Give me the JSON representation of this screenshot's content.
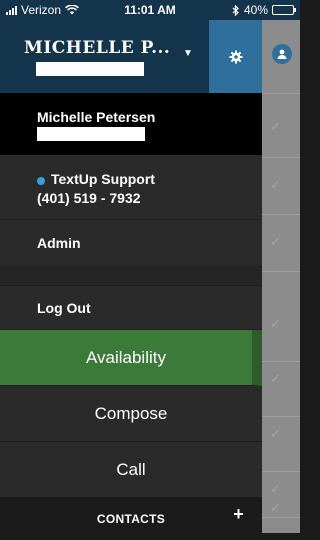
{
  "status_bar": {
    "carrier": "Verizon",
    "time": "11:01 AM",
    "battery": "40%",
    "battery_level": 0.4
  },
  "header": {
    "name": "MICHELLE P..."
  },
  "drawer": {
    "user_name": "Michelle Petersen",
    "team": {
      "name": "TextUp Support",
      "phone": "(401) 519 - 7932",
      "dot_color": "#3d9be0"
    },
    "admin_label": "Admin",
    "logout_label": "Log Out",
    "actions": [
      {
        "label": "Availability",
        "active": true
      },
      {
        "label": "Compose",
        "active": false
      },
      {
        "label": "Call",
        "active": false
      }
    ],
    "contacts_label": "CONTACTS"
  },
  "colors": {
    "header_bg": "#13344a",
    "settings_bg": "#2f6f9b",
    "active_green": "#3c7a3a"
  }
}
